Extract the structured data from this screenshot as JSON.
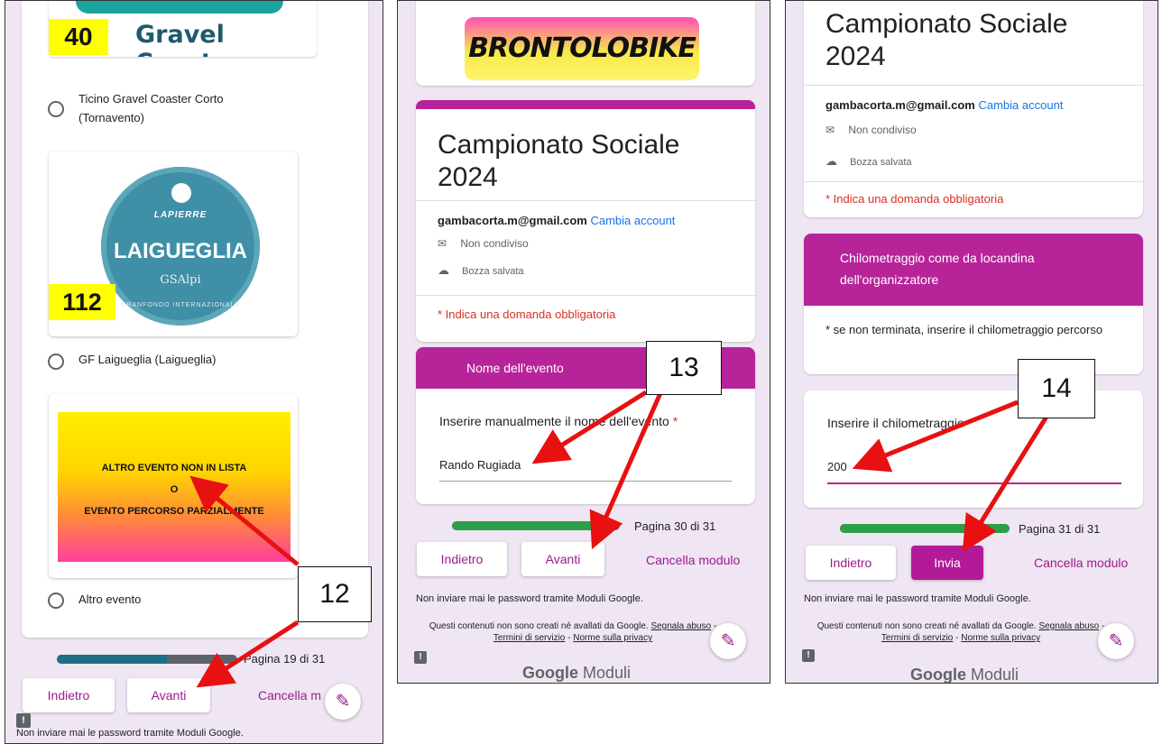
{
  "panel1": {
    "event1": {
      "tag": "40",
      "banner": "Gravel Coaster",
      "label": "Ticino Gravel Coaster Corto (Tornavento)"
    },
    "event2": {
      "tag": "112",
      "brand": "LAPIERRE",
      "place": "LAIGUEGLIA",
      "sponsor": "GSAlpi",
      "ring": "GRANFONDO INTERNAZIONALE",
      "label": "GF Laigueglia (Laigueglia)"
    },
    "event3": {
      "line1": "ALTRO EVENTO NON IN LISTA",
      "line2": "O",
      "line3": "EVENTO PERCORSO PARZIALMENTE",
      "label": "Altro evento"
    },
    "progress": {
      "text": "Pagina 19 di 31",
      "fraction": 0.613
    },
    "back": "Indietro",
    "next": "Avanti",
    "clear": "Cancella m",
    "disclaimer": "Non inviare mai le password tramite Moduli Google.",
    "callout": "12"
  },
  "panel2": {
    "logo": "BRONTOLOBIKE",
    "title": "Campionato Sociale 2024",
    "email": "gambacorta.m@gmail.com",
    "change": "Cambia account",
    "shared": "Non condiviso",
    "draft": "Bozza salvata",
    "required": "* Indica una domanda obbligatoria",
    "section": "Nome dell'evento",
    "question": "Inserire manualmente il nome dell'evento",
    "asterisk": "*",
    "answer": "Rando Rugiada",
    "progress": {
      "text": "Pagina 30 di 31",
      "fraction": 0.968
    },
    "back": "Indietro",
    "next": "Avanti",
    "clear": "Cancella modulo",
    "disclaimer": "Non inviare mai le password tramite Moduli Google.",
    "legal1": "Questi contenuti non sono creati né avallati da Google.",
    "legal_report": "Segnala abuso",
    "legal_terms": "Termini di servizio",
    "legal_privacy": "Norme sulla privacy",
    "footer_brand1": "Google",
    "footer_brand2": "Moduli",
    "callout": "13"
  },
  "panel3": {
    "title": "Campionato Sociale 2024",
    "email": "gambacorta.m@gmail.com",
    "change": "Cambia account",
    "shared": "Non condiviso",
    "draft": "Bozza salvata",
    "required": "* Indica una domanda obbligatoria",
    "section": "Chilometraggio come da locandina dell'organizzatore",
    "note": "* se non terminata, inserire il chilometraggio percorso",
    "question": "Inserire il chilometraggio",
    "answer": "200",
    "progress": {
      "text": "Pagina 31 di 31",
      "fraction": 1.0
    },
    "back": "Indietro",
    "submit": "Invia",
    "clear": "Cancella modulo",
    "disclaimer": "Non inviare mai le password tramite Moduli Google.",
    "legal1": "Questi contenuti non sono creati né avallati da Google.",
    "legal_report": "Segnala abuso",
    "legal_terms": "Termini di servizio",
    "legal_privacy": "Norme sulla privacy",
    "footer_brand1": "Google",
    "footer_brand2": "Moduli",
    "callout": "14"
  },
  "colors": {
    "accent": "#b7249a",
    "progress_fill": "#2e9e48",
    "progress_track": "#5f6368",
    "arrow": "#e81010"
  }
}
